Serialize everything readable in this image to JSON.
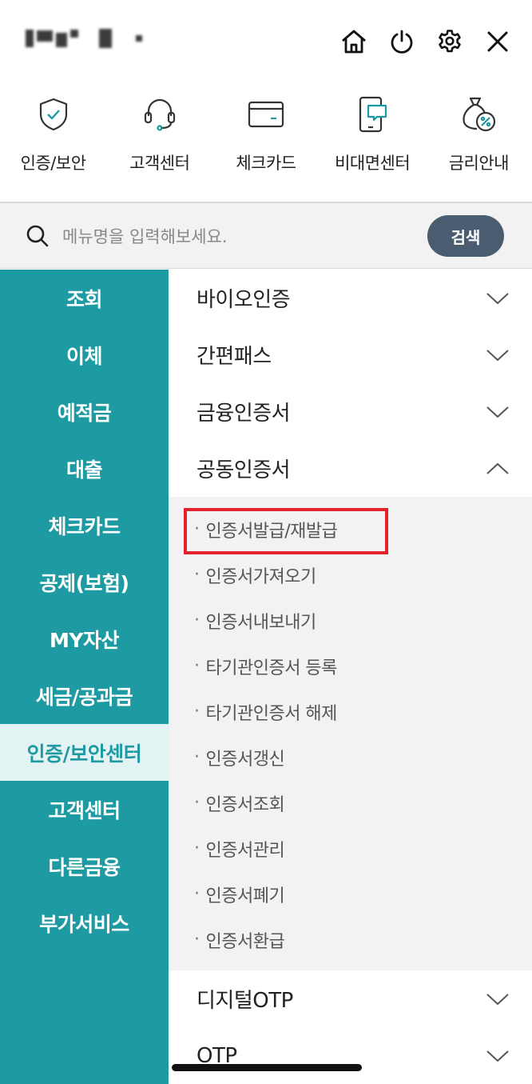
{
  "header": {
    "icons": [
      "home-icon",
      "power-icon",
      "gear-icon",
      "close-icon"
    ]
  },
  "quick_menu": [
    {
      "label": "인증/보안",
      "icon": "shield-check-icon"
    },
    {
      "label": "고객센터",
      "icon": "headset-icon"
    },
    {
      "label": "체크카드",
      "icon": "card-icon"
    },
    {
      "label": "비대면센터",
      "icon": "mobile-chat-icon"
    },
    {
      "label": "금리안내",
      "icon": "money-bag-percent-icon"
    }
  ],
  "search": {
    "placeholder": "메뉴명을 입력해보세요.",
    "button_label": "검색"
  },
  "sidebar": {
    "items": [
      {
        "label": "조회"
      },
      {
        "label": "이체"
      },
      {
        "label": "예적금"
      },
      {
        "label": "대출"
      },
      {
        "label": "체크카드"
      },
      {
        "label": "공제(보험)"
      },
      {
        "label": "MY자산"
      },
      {
        "label": "세금/공과금"
      },
      {
        "label": "인증/보안센터",
        "active": true
      },
      {
        "label": "고객센터"
      },
      {
        "label": "다른금융"
      },
      {
        "label": "부가서비스"
      }
    ]
  },
  "content": {
    "sections_before": [
      {
        "label": "바이오인증",
        "expanded": false
      },
      {
        "label": "간편패스",
        "expanded": false
      },
      {
        "label": "금융인증서",
        "expanded": false
      }
    ],
    "expanded_section": {
      "label": "공동인증서",
      "expanded": true
    },
    "sub_items": [
      {
        "label": "인증서발급/재발급",
        "highlighted": true
      },
      {
        "label": "인증서가져오기"
      },
      {
        "label": "인증서내보내기"
      },
      {
        "label": "타기관인증서 등록"
      },
      {
        "label": "타기관인증서 해제"
      },
      {
        "label": "인증서갱신"
      },
      {
        "label": "인증서조회"
      },
      {
        "label": "인증서관리"
      },
      {
        "label": "인증서폐기"
      },
      {
        "label": "인증서환급"
      }
    ],
    "sections_after": [
      {
        "label": "디지털OTP",
        "expanded": false
      },
      {
        "label": "OTP",
        "expanded": false
      }
    ],
    "bullet": "·"
  },
  "colors": {
    "sidebar_bg": "#1e9aa3",
    "sidebar_active_bg": "#e3f2f3",
    "search_button": "#4a5d70",
    "highlight_border": "#e5232b",
    "icon_teal": "#1e9aa3"
  }
}
